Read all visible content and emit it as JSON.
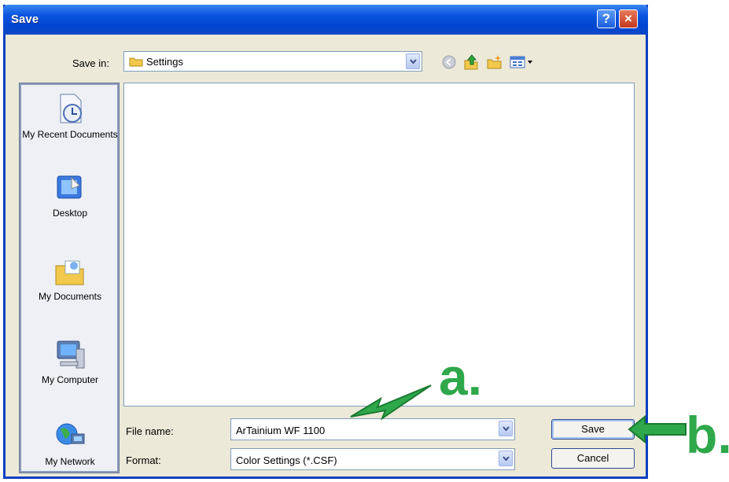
{
  "window": {
    "title": "Save",
    "help_label": "?",
    "close_label": "×"
  },
  "save_in": {
    "label": "Save in:",
    "value": "Settings"
  },
  "places": [
    {
      "label": "My Recent Documents",
      "icon": "recent-documents-icon"
    },
    {
      "label": "Desktop",
      "icon": "desktop-icon"
    },
    {
      "label": "My Documents",
      "icon": "my-documents-icon"
    },
    {
      "label": "My Computer",
      "icon": "my-computer-icon"
    },
    {
      "label": "My Network",
      "icon": "my-network-icon"
    }
  ],
  "file_name": {
    "label": "File name:",
    "value": "ArTainium WF 1100"
  },
  "format": {
    "label": "Format:",
    "value": "Color Settings (*.CSF)"
  },
  "buttons": {
    "save": "Save",
    "cancel": "Cancel"
  },
  "annotations": {
    "a": "a.",
    "b": "b."
  },
  "colors": {
    "title_bar": "#0245d0",
    "dialog_bg": "#ece9d8",
    "annotation": "#2ea84a"
  }
}
